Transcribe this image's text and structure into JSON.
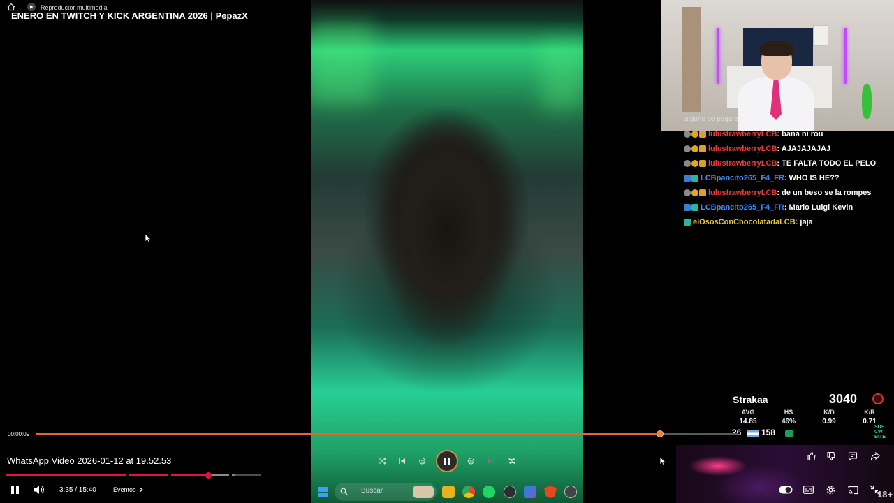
{
  "topbar": {
    "app_title": "Reproductor multimedia",
    "video_title": "ENERO EN TWITCH Y KICK ARGENTINA 2026 | PepazX"
  },
  "chat": {
    "partial_line": "alguno se pegara",
    "messages": [
      {
        "user": "lulustrawberryLCB",
        "text": ": bana ni rou",
        "color": "#e83a3a"
      },
      {
        "user": "lulustrawberryLCB",
        "text": ": AJAJAJAJAJ",
        "color": "#e83a3a"
      },
      {
        "user": "lulustrawberryLCB",
        "text": ": TE FALTA TODO EL PELO",
        "color": "#e83a3a"
      },
      {
        "user": "LCBpancito265_F4_FR",
        "text": ": WHO IS HE??",
        "color": "#3b8bff"
      },
      {
        "user": "lulustrawberryLCB",
        "text": ": de un beso se la rompes",
        "color": "#e83a3a"
      },
      {
        "user": "LCBpancito265_F4_FR",
        "text": ": Mario Luigi Kevin",
        "color": "#3b8bff"
      },
      {
        "user": "elOsosConChocolatadaLCB",
        "text": ": jaja",
        "color": "#e6c44a"
      }
    ]
  },
  "stats": {
    "name": "Strakaa",
    "elo": "3040",
    "headers": [
      "AVG",
      "HS",
      "K/D",
      "K/R"
    ],
    "values": [
      "14.85",
      "46%",
      "0.99",
      "0.71"
    ],
    "kills": "26",
    "deaths": "158",
    "sub_logo": "SUS\nCW\nBITE"
  },
  "player": {
    "time_elapsed": "00:00:09",
    "progress_fraction": 0.889,
    "file_name": "WhatsApp Video 2026-01-12 at 19.52.53",
    "controls": [
      "shuffle-icon",
      "previous-icon",
      "rewind-10-icon",
      "pause-icon",
      "forward-30-icon",
      "next-icon",
      "repeat-off-icon"
    ]
  },
  "youtube": {
    "time": "3:35 / 15:40",
    "chapter": "Eventos",
    "played_fraction": 0.794,
    "buffer_fraction": 0.9
  },
  "taskbar": {
    "search_placeholder": "Buscar",
    "apps": [
      "file-explorer-icon",
      "chrome-icon",
      "spotify-icon",
      "steam-icon",
      "visual-studio-code-icon",
      "brave-icon",
      "media-player-icon"
    ]
  },
  "corner": {
    "age_badge": "18+"
  },
  "colors": {
    "accent": "#e0843f",
    "youtube_red": "#e3123e"
  }
}
